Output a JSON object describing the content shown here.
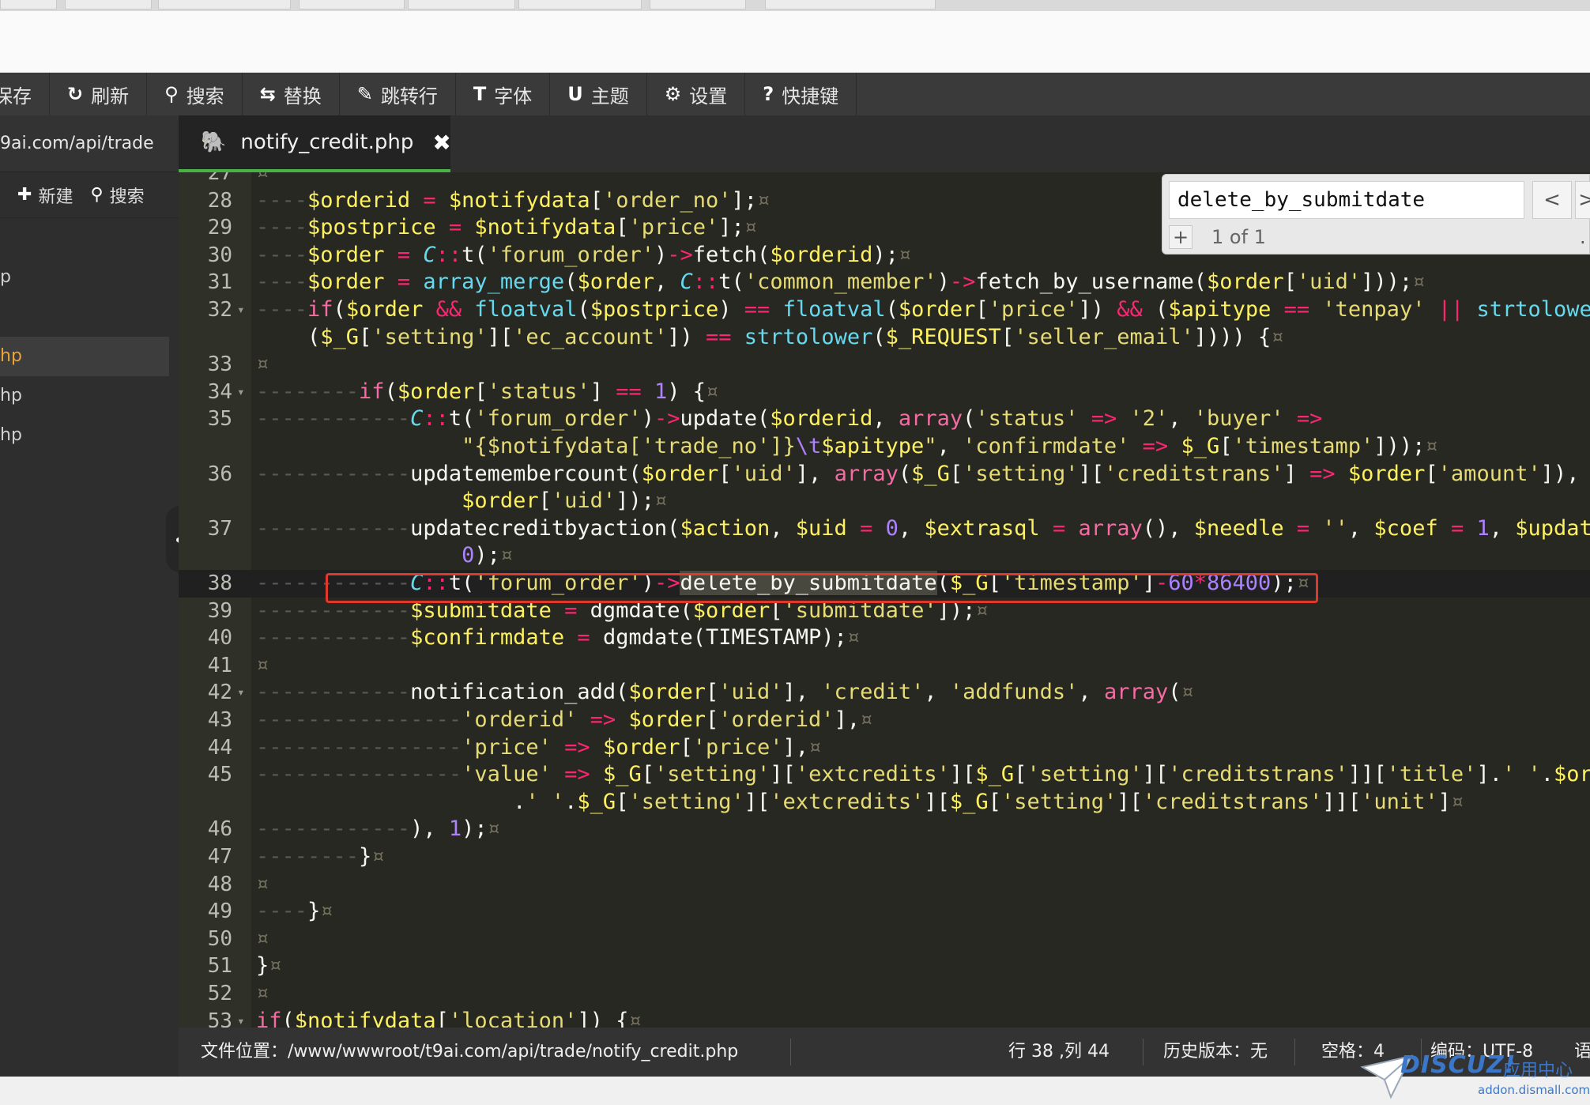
{
  "toolbar": {
    "save": "保存",
    "refresh": "刷新",
    "search": "搜索",
    "replace": "替换",
    "goto": "跳转行",
    "font": "字体",
    "theme": "主题",
    "settings": "设置",
    "shortcuts": "快捷键"
  },
  "sidebar": {
    "path": "9ai.com/api/trade",
    "new_label": "新建",
    "search_label": "搜索",
    "items": [
      {
        "label": "",
        "active": false
      },
      {
        "label": "p",
        "active": false
      },
      {
        "label": "",
        "active": false
      },
      {
        "label": "hp",
        "active": true
      },
      {
        "label": "hp",
        "active": false
      },
      {
        "label": "hp",
        "active": false
      }
    ]
  },
  "tab": {
    "filename": "notify_credit.php",
    "close": "✖"
  },
  "find": {
    "query": "delete_by_submitdate",
    "count": "1 of 1",
    "prev": "<",
    "next": ">",
    "plus": "+",
    "more": "."
  },
  "editor": {
    "line_numbers": [
      "27",
      "28",
      "29",
      "30",
      "31",
      "32",
      "",
      "33",
      "34",
      "35",
      "",
      "36",
      "",
      "37",
      "",
      "38",
      "39",
      "40",
      "41",
      "42",
      "43",
      "44",
      "45",
      "",
      "46",
      "47",
      "48",
      "49",
      "50",
      "51",
      "52",
      "53"
    ]
  },
  "status": {
    "file_location": "文件位置：/www/wwwroot/t9ai.com/api/trade/notify_credit.php",
    "cursor": "行 38 ,列 44",
    "history": "历史版本：无",
    "indent": "空格：4",
    "encoding": "编码：UTF-8",
    "extra": "语"
  },
  "watermark": {
    "logo": "DISCUZ!",
    "cn": "应用中心",
    "url": "addon.dismall.com"
  },
  "colors": {
    "editor_bg": "#272822",
    "toolbar_bg": "#3a3a3a",
    "tab_accent": "#47b347",
    "match_outline": "#e0392b"
  }
}
